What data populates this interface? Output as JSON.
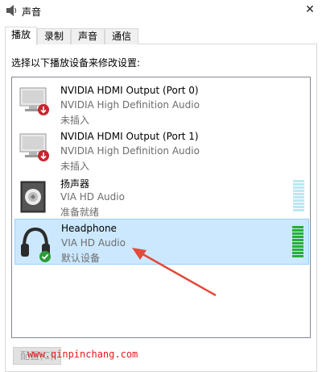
{
  "window": {
    "title": "声音",
    "close": "✕"
  },
  "tabs": [
    {
      "label": "播放",
      "active": true
    },
    {
      "label": "录制",
      "active": false
    },
    {
      "label": "声音",
      "active": false
    },
    {
      "label": "通信",
      "active": false
    }
  ],
  "instruction": "选择以下播放设备来修改设置:",
  "devices": [
    {
      "name": "NVIDIA HDMI Output (Port 0)",
      "driver": "NVIDIA High Definition Audio",
      "status": "未插入",
      "icon": "monitor-unplugged-icon"
    },
    {
      "name": "NVIDIA HDMI Output (Port 1)",
      "driver": "NVIDIA High Definition Audio",
      "status": "未插入",
      "icon": "monitor-unplugged-icon"
    },
    {
      "name": "扬声器",
      "driver": "VIA HD Audio",
      "status": "准备就绪",
      "icon": "speaker-icon"
    },
    {
      "name": "Headphone",
      "driver": "VIA HD Audio",
      "status": "默认设备",
      "icon": "headphone-default-icon"
    }
  ],
  "buttons": {
    "configure": "配置(C)"
  },
  "watermark": "www.qinpinchang.com",
  "colors": {
    "selection": "#cce8ff",
    "meter_active": "#26b035",
    "meter_idle": "#bde7f3",
    "annotation": "#e34a3c"
  }
}
